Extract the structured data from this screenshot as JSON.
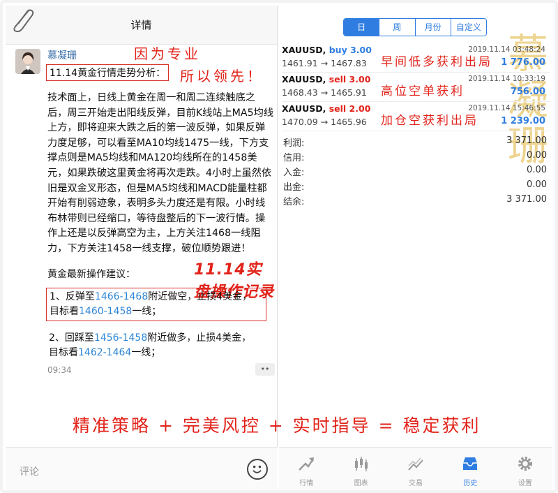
{
  "left": {
    "title": "详情",
    "author": "慕凝珊",
    "headline": "11.14黄金行情走势分析：",
    "slogan_a": "因为专业",
    "slogan_b": "所以领先！",
    "body": "技术面上，日线上黄金在周一和周二连续触底之后，周三开始走出阳线反弹，目前K线站上MA5均线上方，即将迎来大跌之后的第一波反弹，如果反弹力度足够，可以看至MA10均线1475一线，下方支撑点则是MA5均线和MA120均线所在的1458美元，如果跌破这里黄金将再次走跌。4小时上虽然依旧是双金叉形态，但是MA5均线和MACD能量柱都开始有削弱迹象，表明多头力度还是有限。小时线布林带则已经缩口，等待盘整后的下一波行情。操作上还是以反弹高空为主，上方关注1468一线阻力，下方关注1458一线支撑，破位顺势跟进！",
    "advice_title": "黄金最新操作建议：",
    "record_stamp": "11.14实盘操作记录",
    "rec1": {
      "p1": "1、反弹至",
      "r1": "1466-1468",
      "p2": "附近做空，止损4美金，",
      "p3": "目标看",
      "r2": "1460-1458",
      "p4": "一线；"
    },
    "rec2": {
      "p1": "2、回踩至",
      "r1": "1456-1458",
      "p2": "附近做多，止损4美金，",
      "p3": "目标看",
      "r2": "1462-1464",
      "p4": "一线；"
    },
    "time": "09:34",
    "more": "••",
    "comment_placeholder": "评论"
  },
  "right": {
    "segments": [
      {
        "label": "日",
        "active": true
      },
      {
        "label": "周",
        "active": false
      },
      {
        "label": "月份",
        "active": false
      },
      {
        "label": "自定义",
        "active": false
      }
    ],
    "trades": [
      {
        "symbol": "XAUUSD,",
        "side": "buy 3.00",
        "side_color": "#2f7de1",
        "time": "2019.11.14 03:48:24",
        "price": "1461.91 → 1467.83",
        "note": "早间低多获利出局",
        "pl": "1 776.00"
      },
      {
        "symbol": "XAUUSD,",
        "side": "sell 3.00",
        "side_color": "#e2231a",
        "time": "2019.11.14 10:33:19",
        "price": "1468.43 → 1465.91",
        "note": "高位空单获利",
        "pl": "756.00"
      },
      {
        "symbol": "XAUUSD,",
        "side": "sell 2.00",
        "side_color": "#e2231a",
        "time": "2019.11.14 15:46:55",
        "price": "1470.09 → 1465.96",
        "note": "加仓空获利出局",
        "pl": "1 239.00"
      }
    ],
    "summary": [
      {
        "label": "利润:",
        "value": "3 371.00"
      },
      {
        "label": "信用:",
        "value": "0.00"
      },
      {
        "label": "入金:",
        "value": "0.00"
      },
      {
        "label": "出金:",
        "value": "0.00"
      },
      {
        "label": "结余:",
        "value": "3 371.00"
      }
    ],
    "watermark": "慕凝珊",
    "tabs": [
      {
        "label": "行情",
        "icon": "quotes-icon",
        "active": false
      },
      {
        "label": "图表",
        "icon": "chart-icon",
        "active": false
      },
      {
        "label": "交易",
        "icon": "trade-icon",
        "active": false
      },
      {
        "label": "历史",
        "icon": "history-icon",
        "active": true
      },
      {
        "label": "设置",
        "icon": "settings-icon",
        "active": false
      }
    ]
  },
  "bottom_slogan": "精准策略 + 完美风控 + 实时指导 = 稳定获利"
}
